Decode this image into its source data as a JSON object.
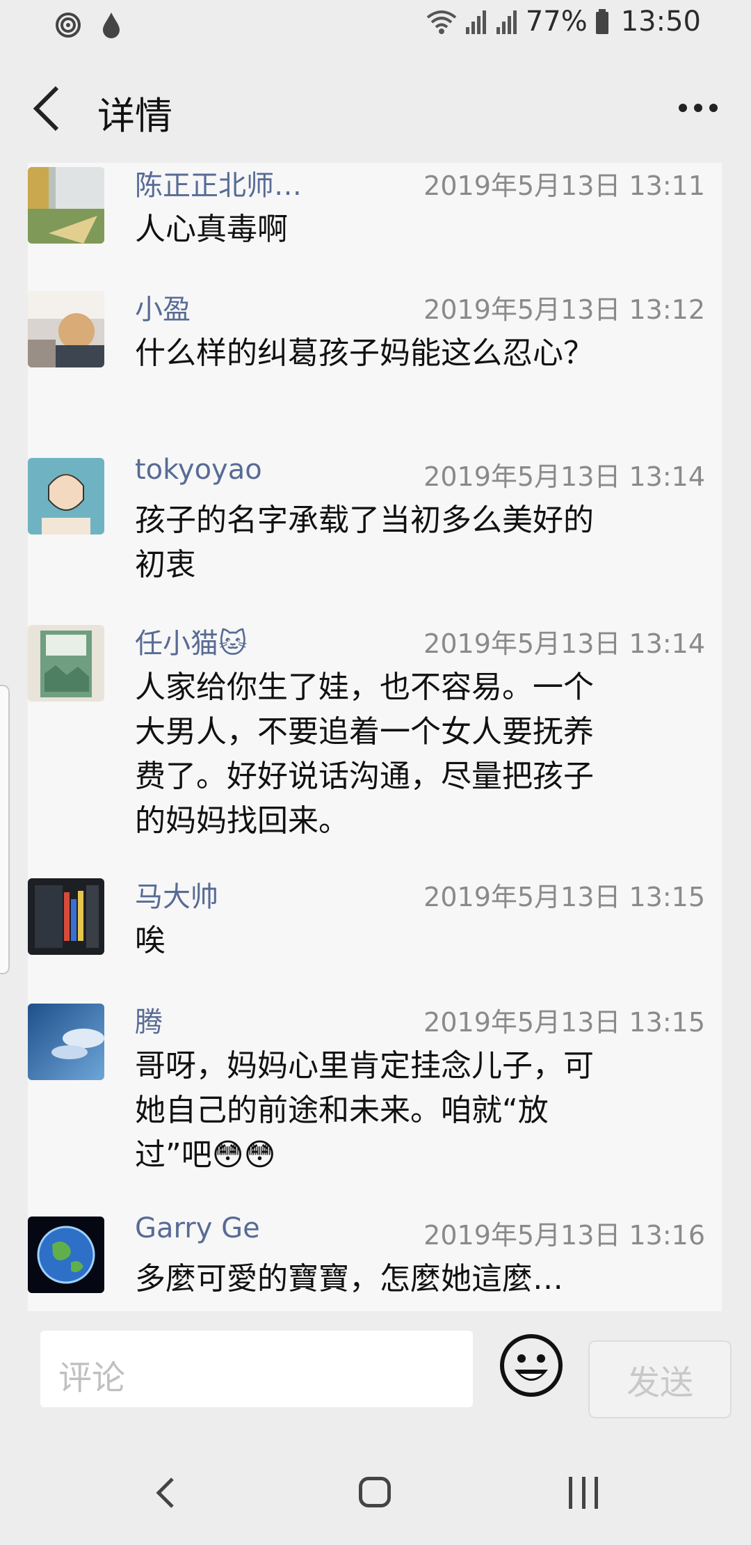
{
  "status": {
    "battery": "77%",
    "time": "13:50",
    "left_icons": [
      "alarm-swirl-icon",
      "water-drop-icon"
    ],
    "right_icons": [
      "wifi-icon",
      "signal-icon",
      "signal-icon",
      "battery-icon"
    ]
  },
  "nav": {
    "title": "详情",
    "back_icon": "chevron-left-icon",
    "more_icon": "more-dots-icon"
  },
  "comments": [
    {
      "name": "陈正正北师…",
      "time": "2019年5月13日 13:11",
      "text": "人心真毒啊"
    },
    {
      "name": "小盈",
      "time": "2019年5月13日 13:12",
      "text": "什么样的纠葛孩子妈能这么忍心？"
    },
    {
      "name": "tokyoyao",
      "time": "2019年5月13日 13:14",
      "text": "孩子的名字承载了当初多么美好的初衷"
    },
    {
      "name": "任小猫🐱",
      "time": "2019年5月13日 13:14",
      "text": "人家给你生了娃，也不容易。一个大男人，不要追着一个女人要抚养费了。好好说话沟通，尽量把孩子的妈妈找回来。"
    },
    {
      "name": "马大帅",
      "time": "2019年5月13日 13:15",
      "text": "唉"
    },
    {
      "name": "腾",
      "time": "2019年5月13日 13:15",
      "text": "哥呀，妈妈心里肯定挂念儿子，可她自己的前途和未来。咱就“放过”吧😳😳"
    },
    {
      "name": "Garry Ge",
      "time": "2019年5月13日 13:16",
      "text": "多麼可愛的寶寶，怎麼她這麼…"
    }
  ],
  "input": {
    "placeholder": "评论",
    "send_label": "发送",
    "emoji_icon": "smiley-icon"
  },
  "colors": {
    "name": "#576b95",
    "background": "#ededed",
    "panel": "#f7f7f7"
  }
}
